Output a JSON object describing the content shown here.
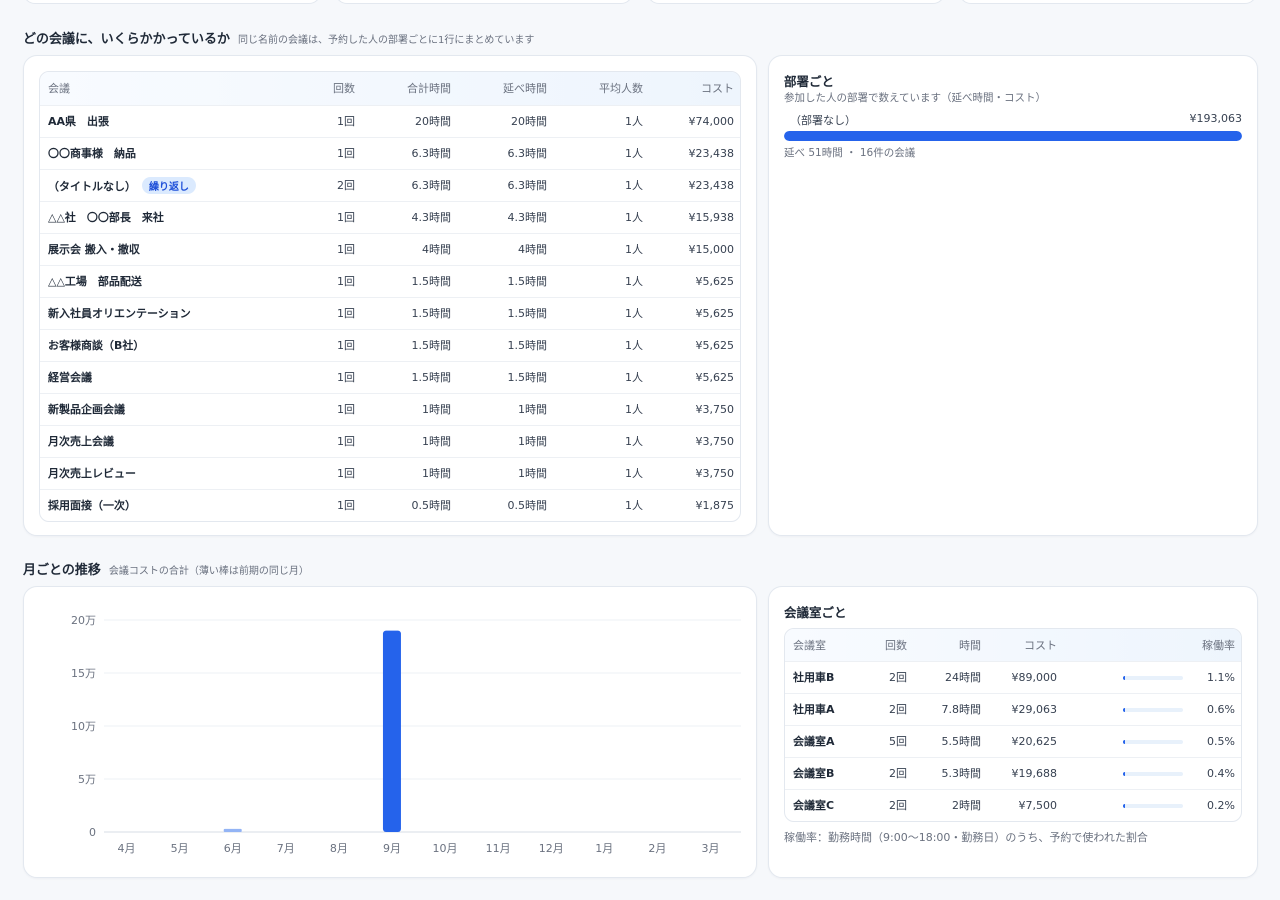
{
  "meetings_section": {
    "title": "どの会議に、いくらかかっているか",
    "subtitle": "同じ名前の会議は、予約した人の部署ごとに1行にまとめています",
    "columns": [
      "会議",
      "回数",
      "合計時間",
      "延べ時間",
      "平均人数",
      "コスト"
    ],
    "rows": [
      {
        "name": "AA県　出張",
        "count": "1回",
        "total": "20時間",
        "person": "20時間",
        "avg": "1人",
        "cost": "¥74,000"
      },
      {
        "name": "〇〇商事様　納品",
        "count": "1回",
        "total": "6.3時間",
        "person": "6.3時間",
        "avg": "1人",
        "cost": "¥23,438"
      },
      {
        "name": "（タイトルなし）",
        "badge": "繰り返し",
        "count": "2回",
        "total": "6.3時間",
        "person": "6.3時間",
        "avg": "1人",
        "cost": "¥23,438"
      },
      {
        "name": "△△社　〇〇部長　来社",
        "count": "1回",
        "total": "4.3時間",
        "person": "4.3時間",
        "avg": "1人",
        "cost": "¥15,938"
      },
      {
        "name": "展示会 搬入・撤収",
        "count": "1回",
        "total": "4時間",
        "person": "4時間",
        "avg": "1人",
        "cost": "¥15,000"
      },
      {
        "name": "△△工場　部品配送",
        "count": "1回",
        "total": "1.5時間",
        "person": "1.5時間",
        "avg": "1人",
        "cost": "¥5,625"
      },
      {
        "name": "新入社員オリエンテーション",
        "count": "1回",
        "total": "1.5時間",
        "person": "1.5時間",
        "avg": "1人",
        "cost": "¥5,625"
      },
      {
        "name": "お客様商談（B社）",
        "count": "1回",
        "total": "1.5時間",
        "person": "1.5時間",
        "avg": "1人",
        "cost": "¥5,625"
      },
      {
        "name": "経営会議",
        "count": "1回",
        "total": "1.5時間",
        "person": "1.5時間",
        "avg": "1人",
        "cost": "¥5,625"
      },
      {
        "name": "新製品企画会議",
        "count": "1回",
        "total": "1時間",
        "person": "1時間",
        "avg": "1人",
        "cost": "¥3,750"
      },
      {
        "name": "月次売上会議",
        "count": "1回",
        "total": "1時間",
        "person": "1時間",
        "avg": "1人",
        "cost": "¥3,750"
      },
      {
        "name": "月次売上レビュー",
        "count": "1回",
        "total": "1時間",
        "person": "1時間",
        "avg": "1人",
        "cost": "¥3,750"
      },
      {
        "name": "採用面接（一次）",
        "count": "1回",
        "total": "0.5時間",
        "person": "0.5時間",
        "avg": "1人",
        "cost": "¥1,875"
      }
    ]
  },
  "dept_section": {
    "title": "部署ごと",
    "subtitle": "参加した人の部署で数えています（延べ時間・コスト）",
    "items": [
      {
        "name": "（部署なし）",
        "cost": "¥193,063",
        "share": 1.0,
        "detail": "延べ 51時間 ・ 16件の会議"
      }
    ]
  },
  "monthly_section": {
    "title": "月ごとの推移",
    "subtitle": "会議コストの合計（薄い棒は前期の同じ月）"
  },
  "chart_data": {
    "type": "bar",
    "categories": [
      "4月",
      "5月",
      "6月",
      "7月",
      "8月",
      "9月",
      "10月",
      "11月",
      "12月",
      "1月",
      "2月",
      "3月"
    ],
    "series": [
      {
        "values": [
          0,
          0,
          0,
          0,
          0,
          190000,
          0,
          0,
          0,
          0,
          0,
          0
        ],
        "color": "#2563eb"
      },
      {
        "values": [
          0,
          0,
          3000,
          0,
          0,
          0,
          0,
          0,
          0,
          0,
          0,
          0
        ],
        "color": "#93b4f5"
      }
    ],
    "yticks": [
      0,
      50000,
      100000,
      150000,
      200000
    ],
    "ytick_labels": [
      "0",
      "5万",
      "10万",
      "15万",
      "20万"
    ],
    "ylim": [
      0,
      200000
    ],
    "grid": true
  },
  "rooms_section": {
    "title": "会議室ごと",
    "columns": [
      "会議室",
      "回数",
      "時間",
      "コスト",
      "稼働率"
    ],
    "rows": [
      {
        "name": "社用車B",
        "count": "2回",
        "hours": "24時間",
        "cost": "¥89,000",
        "util": "1.1%",
        "util_value": 1.1
      },
      {
        "name": "社用車A",
        "count": "2回",
        "hours": "7.8時間",
        "cost": "¥29,063",
        "util": "0.6%",
        "util_value": 0.6
      },
      {
        "name": "会議室A",
        "count": "5回",
        "hours": "5.5時間",
        "cost": "¥20,625",
        "util": "0.5%",
        "util_value": 0.5
      },
      {
        "name": "会議室B",
        "count": "2回",
        "hours": "5.3時間",
        "cost": "¥19,688",
        "util": "0.4%",
        "util_value": 0.4
      },
      {
        "name": "会議室C",
        "count": "2回",
        "hours": "2時間",
        "cost": "¥7,500",
        "util": "0.2%",
        "util_value": 0.2
      }
    ],
    "note": "稼働率：勤務時間（9:00〜18:00・勤務日）のうち、予約で使われた割合"
  }
}
